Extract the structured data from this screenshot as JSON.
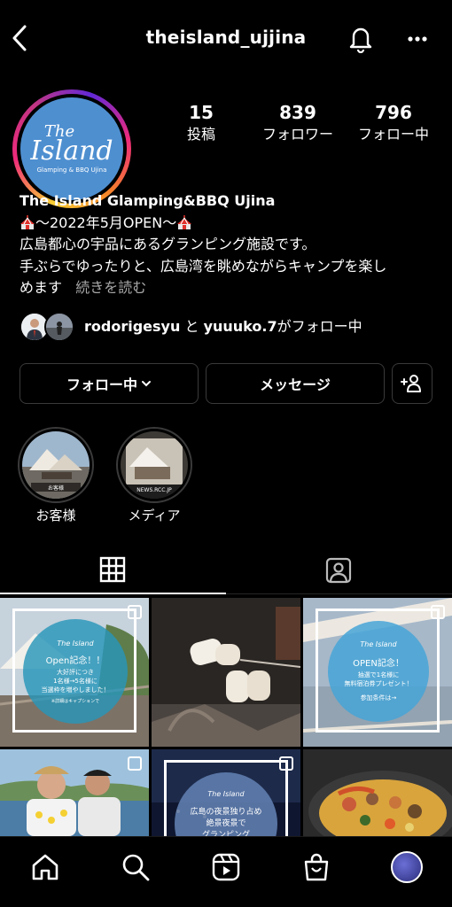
{
  "header": {
    "username": "theisland_ujjina"
  },
  "profile": {
    "logo": {
      "line1": "The",
      "line2": "Island",
      "sub": "Glamping & BBQ Ujina"
    },
    "stats": [
      {
        "value": "15",
        "label": "投稿"
      },
      {
        "value": "839",
        "label": "フォロワー"
      },
      {
        "value": "796",
        "label": "フォロー中"
      }
    ],
    "bio": {
      "name": "The Island Glamping&BBQ Ujina",
      "line1": "〜2022年5月OPEN〜",
      "line2": "広島都心の宇品にあるグランピング施設です。",
      "line3": "手ぶらでゆったりと、広島湾を眺めながらキャンプを楽し",
      "line4": "めます",
      "more": "続きを読む"
    },
    "followed_by": {
      "user1": "rodorigesyu",
      "conj": "と",
      "user2": "yuuuko.7",
      "suffix": "がフォロー中"
    }
  },
  "actions": {
    "follow_label": "フォロー中",
    "message_label": "メッセージ"
  },
  "highlights": [
    {
      "label": "お客様",
      "caption": "お客様"
    },
    {
      "label": "メディア",
      "caption": "NEWS.RCC.JP"
    }
  ],
  "posts": [
    {
      "brand": "The Island",
      "text1": "Open記念！！",
      "text2": "大好評につき",
      "text3": "1名様→5名様に",
      "text4": "当選枠を増やしました！",
      "text5": "※詳細はキャプションで"
    },
    {
      "kind": "photo-marshmallow"
    },
    {
      "brand": "The Island",
      "text1": "OPEN記念！",
      "text2": "抽選で1名様に",
      "text3": "無料宿泊券プレゼント！",
      "text4": "参加条件は→"
    },
    {
      "kind": "photo-people"
    },
    {
      "brand": "The Island",
      "text1": "広島の夜景独り占め",
      "text2": "絶景夜景で",
      "text3": "グランピング"
    },
    {
      "kind": "photo-paella"
    }
  ],
  "colors": {
    "background": "#000000",
    "border": "#3a3a3a",
    "muted": "#a8a8a8",
    "logo_blue": "#4e8fd0"
  }
}
